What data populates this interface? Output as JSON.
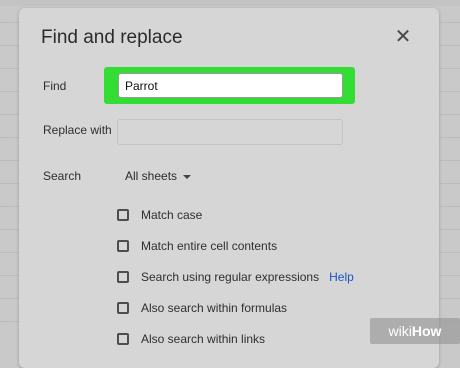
{
  "dialog": {
    "title": "Find and replace",
    "close_icon": "close-icon"
  },
  "find": {
    "label": "Find",
    "value": "Parrot",
    "highlight_color": "#33dd33"
  },
  "replace": {
    "label": "Replace with",
    "value": ""
  },
  "search": {
    "label": "Search",
    "selected": "All sheets"
  },
  "options": [
    {
      "label": "Match case",
      "checked": false
    },
    {
      "label": "Match entire cell contents",
      "checked": false
    },
    {
      "label": "Search using regular expressions",
      "checked": false,
      "help": "Help"
    },
    {
      "label": "Also search within formulas",
      "checked": false
    },
    {
      "label": "Also search within links",
      "checked": false
    }
  ],
  "watermark": {
    "part1": "wiki",
    "part2": "How"
  }
}
